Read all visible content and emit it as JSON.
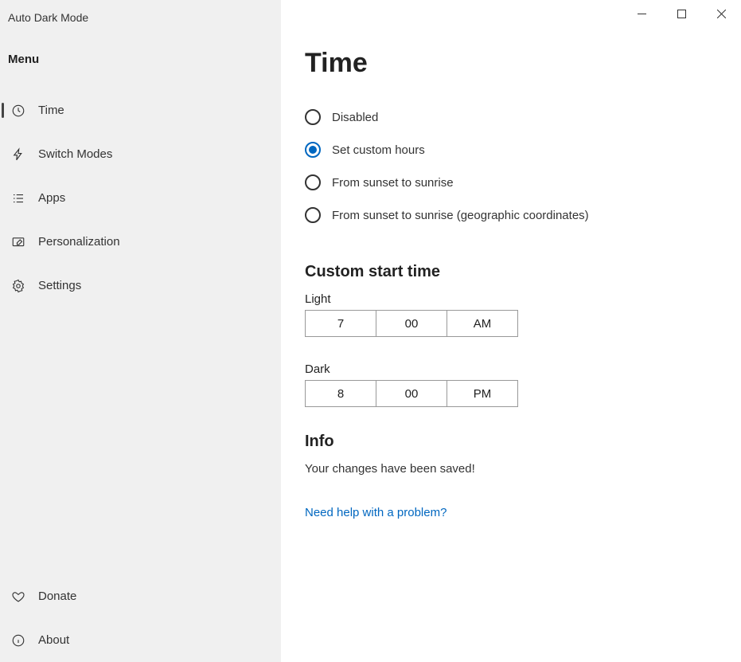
{
  "app_title": "Auto Dark Mode",
  "menu_header": "Menu",
  "sidebar": {
    "items": [
      {
        "label": "Time"
      },
      {
        "label": "Switch Modes"
      },
      {
        "label": "Apps"
      },
      {
        "label": "Personalization"
      },
      {
        "label": "Settings"
      }
    ],
    "footer": [
      {
        "label": "Donate"
      },
      {
        "label": "About"
      }
    ]
  },
  "page": {
    "title": "Time",
    "radio_options": [
      {
        "label": "Disabled"
      },
      {
        "label": "Set custom hours"
      },
      {
        "label": "From sunset to sunrise"
      },
      {
        "label": "From sunset to sunrise (geographic coordinates)"
      }
    ],
    "custom_section_title": "Custom start time",
    "light_label": "Light",
    "light_time": {
      "hour": "7",
      "minute": "00",
      "period": "AM"
    },
    "dark_label": "Dark",
    "dark_time": {
      "hour": "8",
      "minute": "00",
      "period": "PM"
    },
    "info_title": "Info",
    "info_text": "Your changes have been saved!",
    "help_link": "Need help with a problem?"
  }
}
